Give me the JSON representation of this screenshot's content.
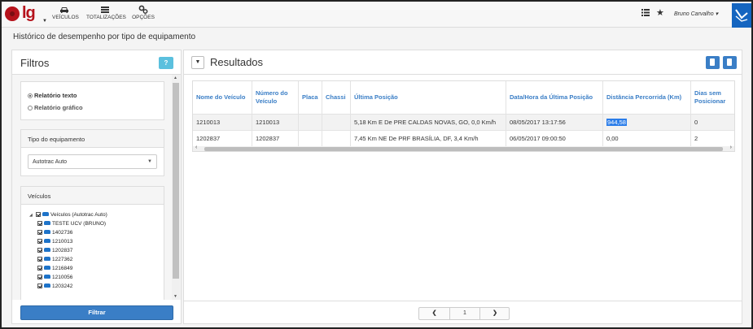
{
  "app": {
    "logo_text": "lg",
    "nav": [
      {
        "label": "VEÍCULOS",
        "icon": "car-icon"
      },
      {
        "label": "TOTALIZAÇÕES",
        "icon": "list-icon"
      },
      {
        "label": "OPÇÕES",
        "icon": "gears-icon"
      }
    ],
    "user": "Bruno Carvalho ▾",
    "accent_color": "#3a7ec6",
    "brand_color": "#b5121b"
  },
  "page": {
    "title": "Histórico de desempenho por tipo de equipamento"
  },
  "filters": {
    "title": "Filtros",
    "help_label": "?",
    "report_options": [
      {
        "label": "Relatório texto",
        "selected": true
      },
      {
        "label": "Relatório gráfico",
        "selected": false
      }
    ],
    "equipment": {
      "label": "Tipo do equipamento",
      "selected": "Autotrac Auto"
    },
    "vehicles": {
      "label": "Veículos",
      "root": "Veículos (Autotrac Auto)",
      "items": [
        "TESTE UCV (BRUNO)",
        "1402736",
        "1210013",
        "1202837",
        "1227362",
        "1216849",
        "1210056",
        "1203242"
      ]
    },
    "submit_label": "Filtrar"
  },
  "results": {
    "title": "Resultados",
    "toggle_label": "▼",
    "columns": [
      "Nome do Veículo",
      "Número do Veículo",
      "Placa",
      "Chassi",
      "Última Posição",
      "Data/Hora da Última Posição",
      "Distância Percorrida (Km)",
      "Dias sem Posicionar"
    ],
    "rows": [
      [
        "1210013",
        "1210013",
        "",
        "",
        "5,18 Km E De PRE CALDAS NOVAS, GO, 0,0 Km/h",
        "08/05/2017 13:17:56",
        "944,58",
        "0"
      ],
      [
        "1202837",
        "1202837",
        "",
        "",
        "7,45 Km NE De PRF BRASÍLIA, DF, 3,4 Km/h",
        "06/05/2017 09:00:50",
        "0,00",
        "2"
      ]
    ],
    "pagination": {
      "prev": "❮",
      "page": "1",
      "next": "❯"
    }
  }
}
